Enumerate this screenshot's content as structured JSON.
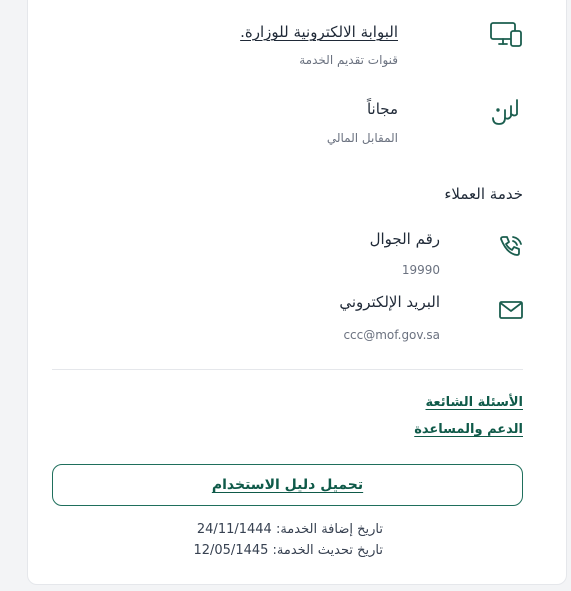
{
  "channels": {
    "value": "البوابة الالكترونية للوزارة.",
    "label": "قنوات تقديم الخدمة",
    "icon": "desktop-mobile-icon"
  },
  "fee": {
    "value": "مجاناً",
    "label": "المقابل المالي",
    "icon": "riyal-icon"
  },
  "customer_service": {
    "title": "خدمة العملاء",
    "phone": {
      "label": "رقم الجوال",
      "value": "19990",
      "icon": "phone-icon"
    },
    "email": {
      "label": "البريد الإلكتروني",
      "value": "ccc@mof.gov.sa",
      "icon": "mail-icon"
    }
  },
  "links": {
    "faq": "الأسئلة الشائعة",
    "support": "الدعم والمساعدة"
  },
  "download_button": "تحميل دليل الاستخدام",
  "dates": {
    "added": "تاريخ إضافة الخدمة: 24/11/1444",
    "updated": "تاريخ تحديث الخدمة: 12/05/1445"
  },
  "colors": {
    "accent": "#1b5e4f",
    "link": "#0f5a49"
  }
}
